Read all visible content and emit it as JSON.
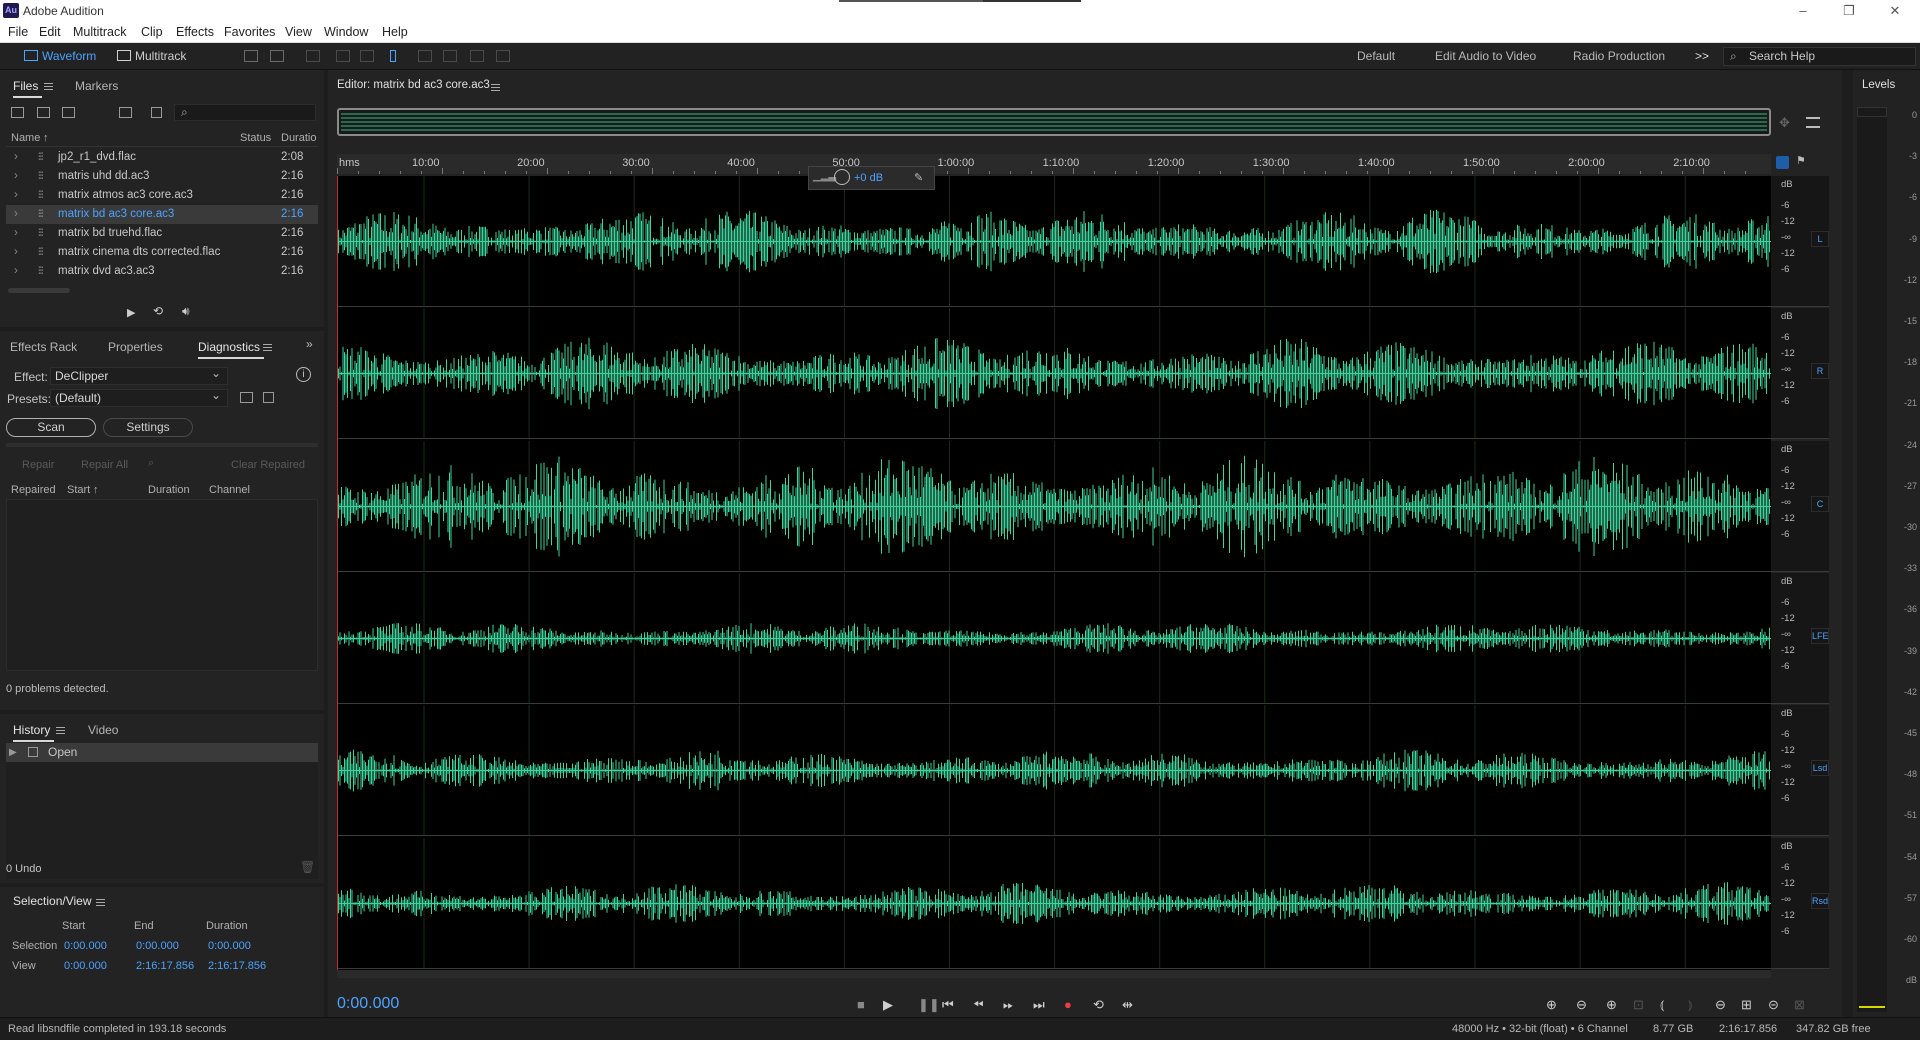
{
  "window": {
    "app_title": "Adobe Audition",
    "logo": "Au"
  },
  "menu": [
    "File",
    "Edit",
    "Multitrack",
    "Clip",
    "Effects",
    "Favorites",
    "View",
    "Window",
    "Help"
  ],
  "toolbar": {
    "waveform_label": "Waveform",
    "multitrack_label": "Multitrack",
    "workspaces": [
      "Default",
      "Edit Audio to Video",
      "Radio Production"
    ],
    "overflow": ">>",
    "search_placeholder": "Search Help"
  },
  "files_panel": {
    "tabs": [
      "Files",
      "Markers"
    ],
    "columns": {
      "name": "Name",
      "sort_arrow": "↑",
      "status": "Status",
      "duration": "Duratio"
    },
    "rows": [
      {
        "name": "jp2_r1_dvd.flac",
        "duration": "2:08",
        "selected": false
      },
      {
        "name": "matris uhd dd.ac3",
        "duration": "2:16",
        "selected": false
      },
      {
        "name": "matrix atmos ac3 core.ac3",
        "duration": "2:16",
        "selected": false
      },
      {
        "name": "matrix bd ac3 core.ac3",
        "duration": "2:16",
        "selected": true
      },
      {
        "name": "matrix bd truehd.flac",
        "duration": "2:16",
        "selected": false
      },
      {
        "name": "matrix cinema dts corrected.flac",
        "duration": "2:16",
        "selected": false
      },
      {
        "name": "matrix dvd ac3.ac3",
        "duration": "2:16",
        "selected": false
      }
    ]
  },
  "diagnostics_panel": {
    "tabs": [
      "Effects Rack",
      "Properties",
      "Diagnostics"
    ],
    "effect_label": "Effect:",
    "effect_value": "DeClipper",
    "presets_label": "Presets:",
    "presets_value": "(Default)",
    "scan": "Scan",
    "settings": "Settings",
    "repair": "Repair",
    "repair_all": "Repair All",
    "clear_repaired": "Clear Repaired",
    "columns": [
      "Repaired",
      "Start",
      "Duration",
      "Channel"
    ],
    "status": "0 problems detected."
  },
  "history_panel": {
    "tabs": [
      "History",
      "Video"
    ],
    "items": [
      "Open"
    ],
    "undo": "0 Undo"
  },
  "selection_view": {
    "title": "Selection/View",
    "headers": [
      "Start",
      "End",
      "Duration"
    ],
    "rows": [
      {
        "label": "Selection",
        "start": "0:00.000",
        "end": "0:00.000",
        "duration": "0:00.000"
      },
      {
        "label": "View",
        "start": "0:00.000",
        "end": "2:16:17.856",
        "duration": "2:16:17.856"
      }
    ]
  },
  "editor": {
    "title": "Editor: matrix bd ac3 core.ac3",
    "ruler_unit": "hms",
    "ruler_ticks": [
      "10:00",
      "20:00",
      "30:00",
      "40:00",
      "50:00",
      "1:00:00",
      "1:10:00",
      "1:20:00",
      "1:30:00",
      "1:40:00",
      "1:50:00",
      "2:00:00",
      "2:10:00"
    ],
    "channels": [
      "L",
      "R",
      "C",
      "LFE",
      "Lsd",
      "Rsd"
    ],
    "db_scale": {
      "unit": "dB",
      "labels": [
        "-6",
        "-12",
        "-∞",
        "-12",
        "-6"
      ]
    },
    "hud_gain": "+0 dB",
    "current_time": "0:00.000"
  },
  "levels": {
    "title": "Levels",
    "scale": [
      "0",
      "-3",
      "-6",
      "-9",
      "-12",
      "-15",
      "-18",
      "-21",
      "-24",
      "-27",
      "-30",
      "-33",
      "-36",
      "-39",
      "-42",
      "-45",
      "-48",
      "-51",
      "-54",
      "-57",
      "-60",
      "dB"
    ]
  },
  "status": {
    "message": "Read libsndfile completed in 193.18 seconds",
    "format": "48000 Hz • 32-bit (float) • 6 Channel",
    "size": "8.77 GB",
    "duration": "2:16:17.856",
    "free": "347.82 GB free"
  },
  "colors": {
    "waveform": "#3ed49b",
    "accent": "#4da3ff",
    "record": "#e84040"
  }
}
